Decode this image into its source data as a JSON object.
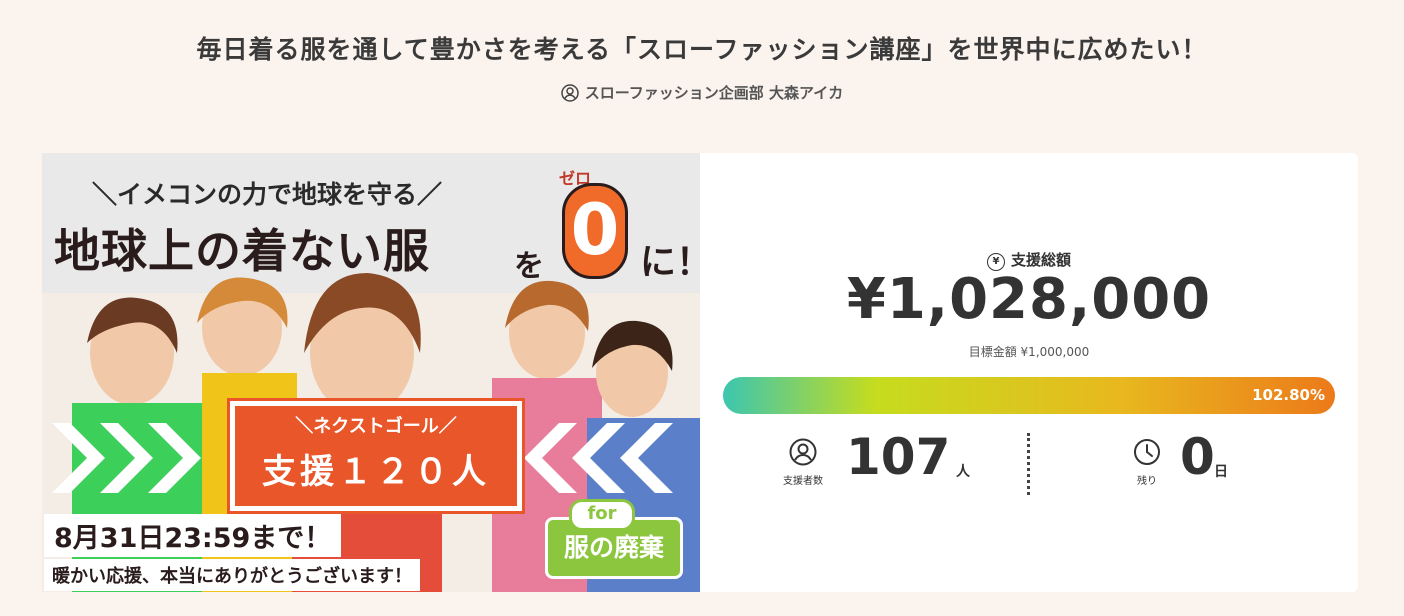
{
  "project": {
    "title": "毎日着る服を通して豊かさを考える「スローファッション講座」を世界中に広めたい！",
    "owner": "スローファッション企画部 大森アイカ",
    "owner_icon": "user-circle-icon"
  },
  "hero": {
    "tagline": "＼イメコンの力で地球を守る／",
    "headline": "地球上の着ない服",
    "headline_particle": "を",
    "zero_ruby": "ゼロ",
    "zero": "0",
    "headline_end": "に！",
    "next_goal_label": "＼ネクストゴール／",
    "next_goal_value": "支援１２０人",
    "deadline": "8月31日23:59まで！",
    "thanks": "暖かい応援、本当にありがとうございます！",
    "for_label": "for",
    "disposal_label": "服の廃棄"
  },
  "stats": {
    "total_label": "支援総額",
    "total_icon": "yen-circle-icon",
    "total_amount": "¥1,028,000",
    "goal_text": "目標金額 ¥1,000,000",
    "progress_text": "102.80%",
    "progress_fraction": 1.028,
    "supporters_caption": "支援者数",
    "supporters_count": "107",
    "supporters_unit": "人",
    "supporters_icon": "user-circle-icon",
    "remaining_caption": "残り",
    "remaining_count": "0",
    "remaining_unit": "日",
    "remaining_icon": "clock-icon"
  },
  "colors": {
    "background": "#fbf3ee",
    "accent_orange": "#e8562a",
    "accent_green": "#8cc63f",
    "progress_start": "#3cc6b0",
    "progress_end": "#ec7a1a"
  }
}
